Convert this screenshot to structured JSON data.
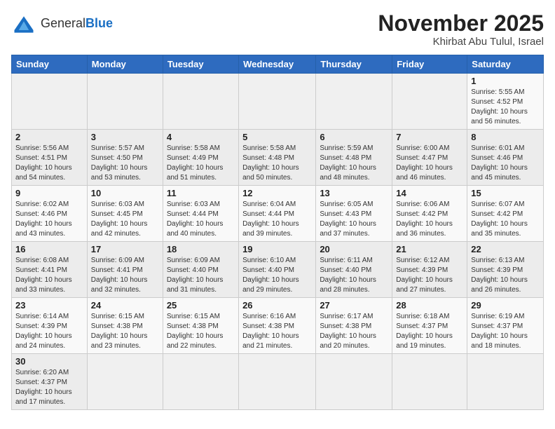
{
  "header": {
    "logo_general": "General",
    "logo_blue": "Blue",
    "month": "November 2025",
    "location": "Khirbat Abu Tulul, Israel"
  },
  "days_of_week": [
    "Sunday",
    "Monday",
    "Tuesday",
    "Wednesday",
    "Thursday",
    "Friday",
    "Saturday"
  ],
  "weeks": [
    [
      {
        "day": "",
        "info": ""
      },
      {
        "day": "",
        "info": ""
      },
      {
        "day": "",
        "info": ""
      },
      {
        "day": "",
        "info": ""
      },
      {
        "day": "",
        "info": ""
      },
      {
        "day": "",
        "info": ""
      },
      {
        "day": "1",
        "info": "Sunrise: 5:55 AM\nSunset: 4:52 PM\nDaylight: 10 hours and 56 minutes."
      }
    ],
    [
      {
        "day": "2",
        "info": "Sunrise: 5:56 AM\nSunset: 4:51 PM\nDaylight: 10 hours and 54 minutes."
      },
      {
        "day": "3",
        "info": "Sunrise: 5:57 AM\nSunset: 4:50 PM\nDaylight: 10 hours and 53 minutes."
      },
      {
        "day": "4",
        "info": "Sunrise: 5:58 AM\nSunset: 4:49 PM\nDaylight: 10 hours and 51 minutes."
      },
      {
        "day": "5",
        "info": "Sunrise: 5:58 AM\nSunset: 4:48 PM\nDaylight: 10 hours and 50 minutes."
      },
      {
        "day": "6",
        "info": "Sunrise: 5:59 AM\nSunset: 4:48 PM\nDaylight: 10 hours and 48 minutes."
      },
      {
        "day": "7",
        "info": "Sunrise: 6:00 AM\nSunset: 4:47 PM\nDaylight: 10 hours and 46 minutes."
      },
      {
        "day": "8",
        "info": "Sunrise: 6:01 AM\nSunset: 4:46 PM\nDaylight: 10 hours and 45 minutes."
      }
    ],
    [
      {
        "day": "9",
        "info": "Sunrise: 6:02 AM\nSunset: 4:46 PM\nDaylight: 10 hours and 43 minutes."
      },
      {
        "day": "10",
        "info": "Sunrise: 6:03 AM\nSunset: 4:45 PM\nDaylight: 10 hours and 42 minutes."
      },
      {
        "day": "11",
        "info": "Sunrise: 6:03 AM\nSunset: 4:44 PM\nDaylight: 10 hours and 40 minutes."
      },
      {
        "day": "12",
        "info": "Sunrise: 6:04 AM\nSunset: 4:44 PM\nDaylight: 10 hours and 39 minutes."
      },
      {
        "day": "13",
        "info": "Sunrise: 6:05 AM\nSunset: 4:43 PM\nDaylight: 10 hours and 37 minutes."
      },
      {
        "day": "14",
        "info": "Sunrise: 6:06 AM\nSunset: 4:42 PM\nDaylight: 10 hours and 36 minutes."
      },
      {
        "day": "15",
        "info": "Sunrise: 6:07 AM\nSunset: 4:42 PM\nDaylight: 10 hours and 35 minutes."
      }
    ],
    [
      {
        "day": "16",
        "info": "Sunrise: 6:08 AM\nSunset: 4:41 PM\nDaylight: 10 hours and 33 minutes."
      },
      {
        "day": "17",
        "info": "Sunrise: 6:09 AM\nSunset: 4:41 PM\nDaylight: 10 hours and 32 minutes."
      },
      {
        "day": "18",
        "info": "Sunrise: 6:09 AM\nSunset: 4:40 PM\nDaylight: 10 hours and 31 minutes."
      },
      {
        "day": "19",
        "info": "Sunrise: 6:10 AM\nSunset: 4:40 PM\nDaylight: 10 hours and 29 minutes."
      },
      {
        "day": "20",
        "info": "Sunrise: 6:11 AM\nSunset: 4:40 PM\nDaylight: 10 hours and 28 minutes."
      },
      {
        "day": "21",
        "info": "Sunrise: 6:12 AM\nSunset: 4:39 PM\nDaylight: 10 hours and 27 minutes."
      },
      {
        "day": "22",
        "info": "Sunrise: 6:13 AM\nSunset: 4:39 PM\nDaylight: 10 hours and 26 minutes."
      }
    ],
    [
      {
        "day": "23",
        "info": "Sunrise: 6:14 AM\nSunset: 4:39 PM\nDaylight: 10 hours and 24 minutes."
      },
      {
        "day": "24",
        "info": "Sunrise: 6:15 AM\nSunset: 4:38 PM\nDaylight: 10 hours and 23 minutes."
      },
      {
        "day": "25",
        "info": "Sunrise: 6:15 AM\nSunset: 4:38 PM\nDaylight: 10 hours and 22 minutes."
      },
      {
        "day": "26",
        "info": "Sunrise: 6:16 AM\nSunset: 4:38 PM\nDaylight: 10 hours and 21 minutes."
      },
      {
        "day": "27",
        "info": "Sunrise: 6:17 AM\nSunset: 4:38 PM\nDaylight: 10 hours and 20 minutes."
      },
      {
        "day": "28",
        "info": "Sunrise: 6:18 AM\nSunset: 4:37 PM\nDaylight: 10 hours and 19 minutes."
      },
      {
        "day": "29",
        "info": "Sunrise: 6:19 AM\nSunset: 4:37 PM\nDaylight: 10 hours and 18 minutes."
      }
    ],
    [
      {
        "day": "30",
        "info": "Sunrise: 6:20 AM\nSunset: 4:37 PM\nDaylight: 10 hours and 17 minutes."
      },
      {
        "day": "",
        "info": ""
      },
      {
        "day": "",
        "info": ""
      },
      {
        "day": "",
        "info": ""
      },
      {
        "day": "",
        "info": ""
      },
      {
        "day": "",
        "info": ""
      },
      {
        "day": "",
        "info": ""
      }
    ]
  ]
}
